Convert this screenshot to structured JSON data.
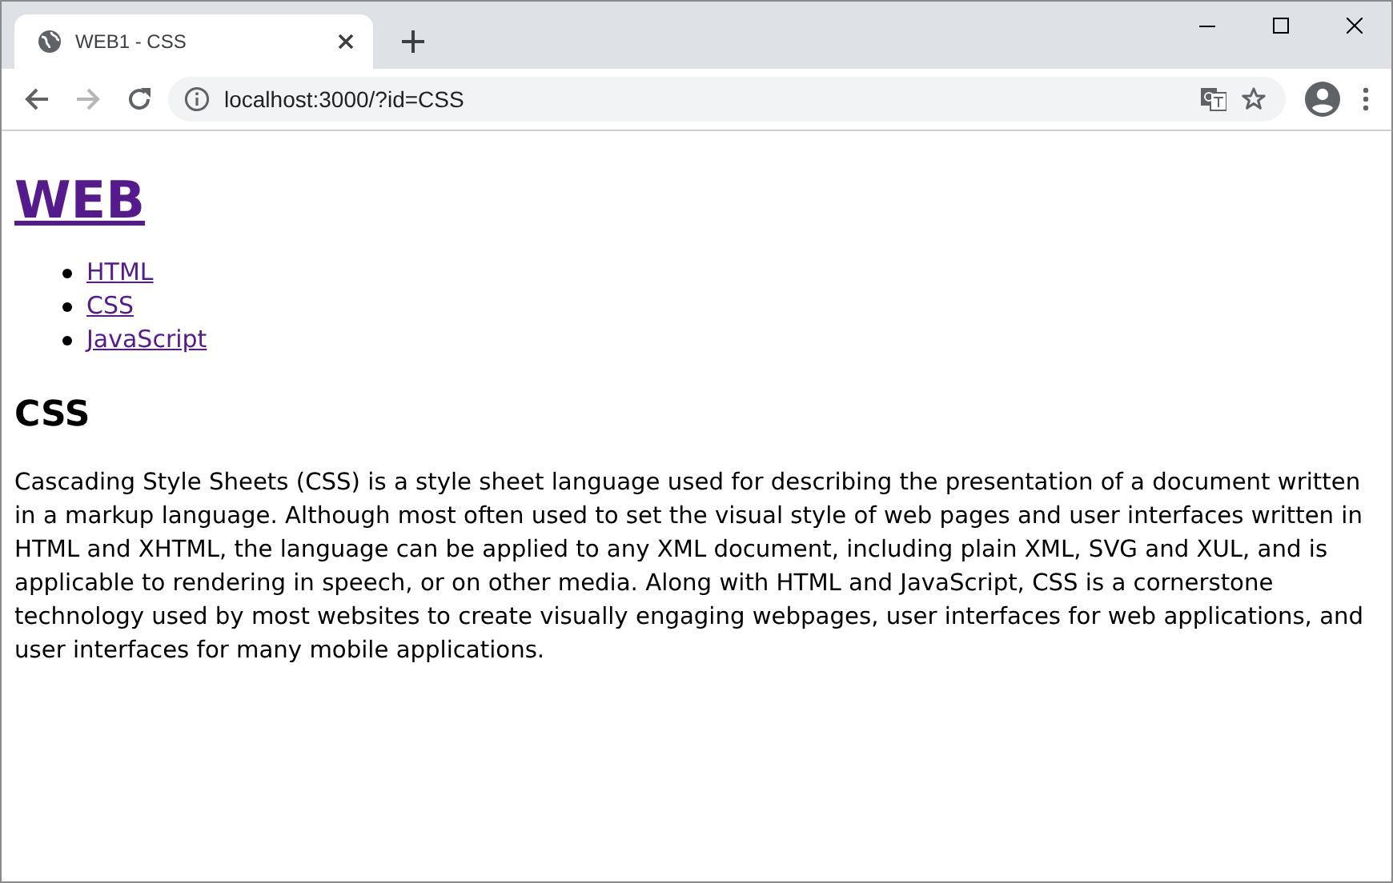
{
  "tabs": [
    {
      "title": "WEB1 - CSS",
      "selected": true
    }
  ],
  "toolbar": {
    "back_disabled": false,
    "forward_disabled": true,
    "url": "localhost:3000/?id=CSS"
  },
  "page": {
    "heading": "WEB",
    "nav": [
      {
        "label": "HTML"
      },
      {
        "label": "CSS"
      },
      {
        "label": "JavaScript"
      }
    ],
    "title": "CSS",
    "body": "Cascading Style Sheets (CSS) is a style sheet language used for describing the presentation of a document written in a markup language. Although most often used to set the visual style of web pages and user interfaces written in HTML and XHTML, the language can be applied to any XML document, including plain XML, SVG and XUL, and is applicable to rendering in speech, or on other media. Along with HTML and JavaScript, CSS is a cornerstone technology used by most websites to create visually engaging webpages, user interfaces for web applications, and user interfaces for many mobile applications."
  }
}
